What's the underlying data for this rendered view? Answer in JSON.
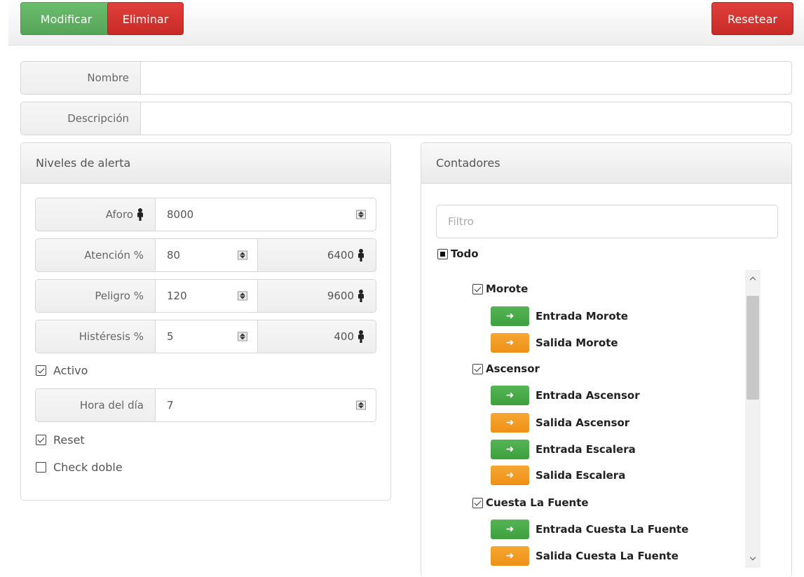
{
  "toolbar": {
    "modify_label": "Modificar",
    "delete_label": "Eliminar",
    "reset_label": "Resetear"
  },
  "form": {
    "name_label": "Nombre",
    "name_value": "",
    "description_label": "Descripción",
    "description_value": ""
  },
  "alerts": {
    "title": "Niveles de alerta",
    "capacity_label": "Aforo",
    "capacity_value": "8000",
    "attention_label": "Atención %",
    "attention_value": "80",
    "attention_count": "6400",
    "danger_label": "Peligro %",
    "danger_value": "120",
    "danger_count": "9600",
    "hysteresis_label": "Histéresis %",
    "hysteresis_value": "5",
    "hysteresis_count": "400",
    "active_label": "Activo",
    "active_checked": true,
    "hour_label": "Hora del día",
    "hour_value": "7",
    "reset_label": "Reset",
    "reset_checked": true,
    "double_check_label": "Check doble",
    "double_check_checked": false
  },
  "counters": {
    "title": "Contadores",
    "filter_placeholder": "Filtro",
    "all_label": "Todo",
    "groups": [
      {
        "label": "Morote",
        "items": [
          {
            "label": "Entrada Morote",
            "kind": "entrada"
          },
          {
            "label": "Salida Morote",
            "kind": "salida"
          }
        ]
      },
      {
        "label": "Ascensor",
        "items": [
          {
            "label": "Entrada Ascensor",
            "kind": "entrada"
          },
          {
            "label": "Salida Ascensor",
            "kind": "salida"
          },
          {
            "label": "Entrada Escalera",
            "kind": "entrada"
          },
          {
            "label": "Salida Escalera",
            "kind": "salida"
          }
        ]
      },
      {
        "label": "Cuesta La Fuente",
        "items": [
          {
            "label": "Entrada Cuesta La Fuente",
            "kind": "entrada"
          },
          {
            "label": "Salida Cuesta La Fuente",
            "kind": "salida"
          }
        ]
      }
    ]
  },
  "colors": {
    "green": "#5cb85c",
    "red": "#d9534f",
    "orange": "#f0ad4e"
  }
}
